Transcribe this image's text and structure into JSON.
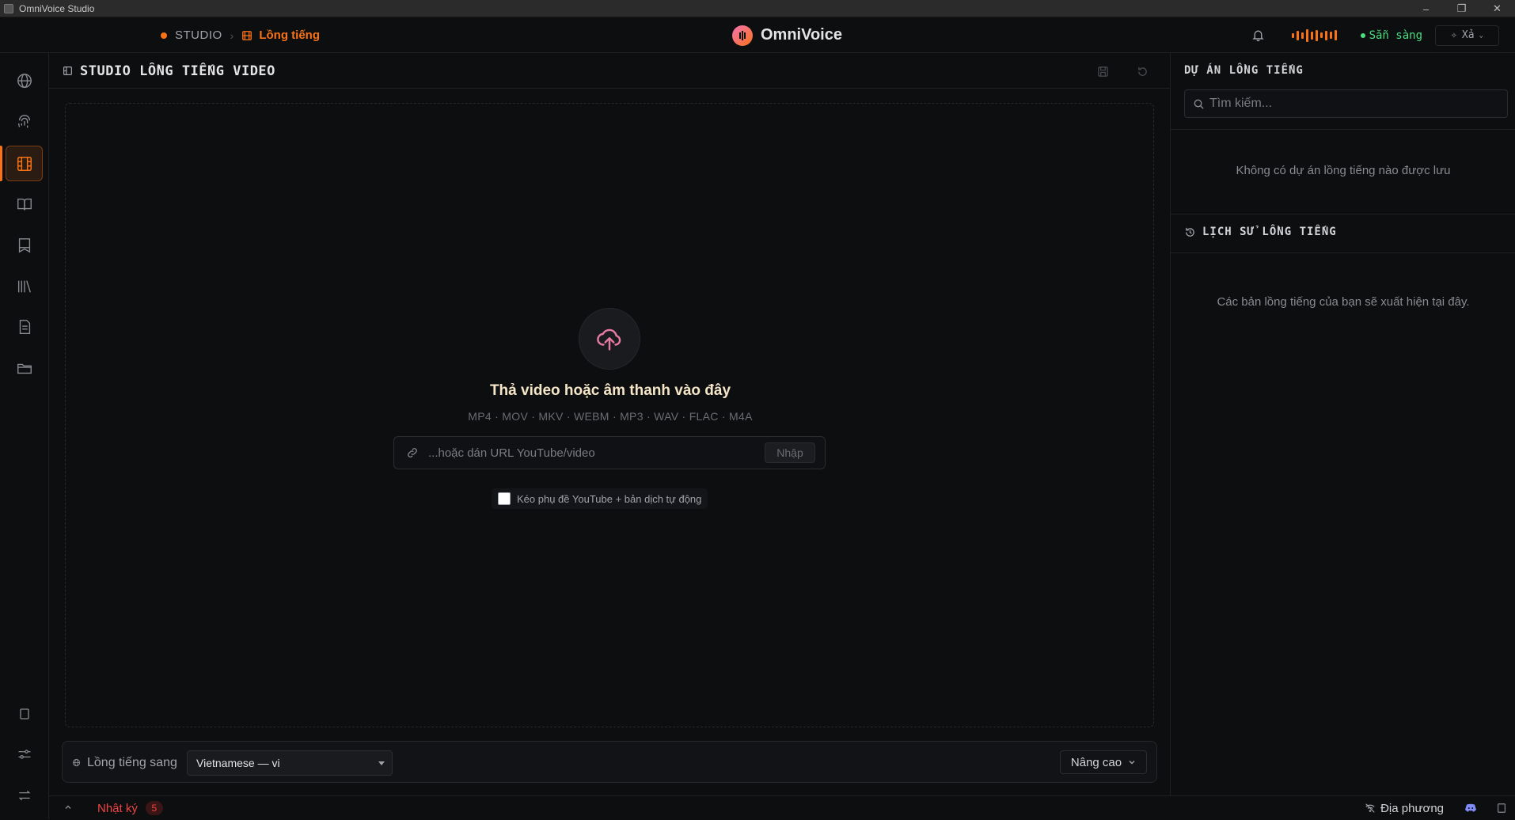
{
  "window": {
    "title": "OmniVoice Studio"
  },
  "header": {
    "breadcrumb_root": "STUDIO",
    "breadcrumb_current": "Lồng tiếng",
    "brand": "OmniVoice",
    "status": "Sẵn sàng",
    "clear_label": "Xả"
  },
  "nav": {
    "items": [
      "globe-icon",
      "fingerprint-icon",
      "film-icon",
      "book-open-icon",
      "bookmark-icon",
      "library-icon",
      "document-icon",
      "folder-icon"
    ],
    "active": "film-icon",
    "bottom_items": [
      "square-icon",
      "sliders-icon",
      "swap-icon"
    ]
  },
  "main": {
    "title": "STUDIO LỒNG TIẾNG VIDEO",
    "drop_title": "Thả video hoặc âm thanh vào đây",
    "drop_formats": "MP4 · MOV · MKV · WEBM · MP3 · WAV · FLAC · M4A",
    "url_placeholder": "...hoặc dán URL YouTube/video",
    "import_label": "Nhập",
    "yt_checkbox_label": "Kéo phụ đề YouTube + bản dịch tự động",
    "target_label": "Lồng tiếng sang",
    "target_language": "Vietnamese — vi",
    "advanced_label": "Nâng cao"
  },
  "sidebar": {
    "projects_title": "DỰ ÁN LỒNG TIẾNG",
    "search_placeholder": "Tìm kiếm...",
    "projects_empty": "Không có dự án lồng tiếng nào được lưu",
    "history_title": "LỊCH SỬ LỒNG TIẾNG",
    "history_empty": "Các bản lồng tiếng của bạn sẽ xuất hiện tại đây."
  },
  "statusbar": {
    "log_label": "Nhật ký",
    "log_count": "5",
    "mode_label": "Địa phương"
  },
  "colors": {
    "accent": "#f97316",
    "ready": "#4ade80",
    "error": "#ef4444",
    "bg": "#0d0e10"
  }
}
